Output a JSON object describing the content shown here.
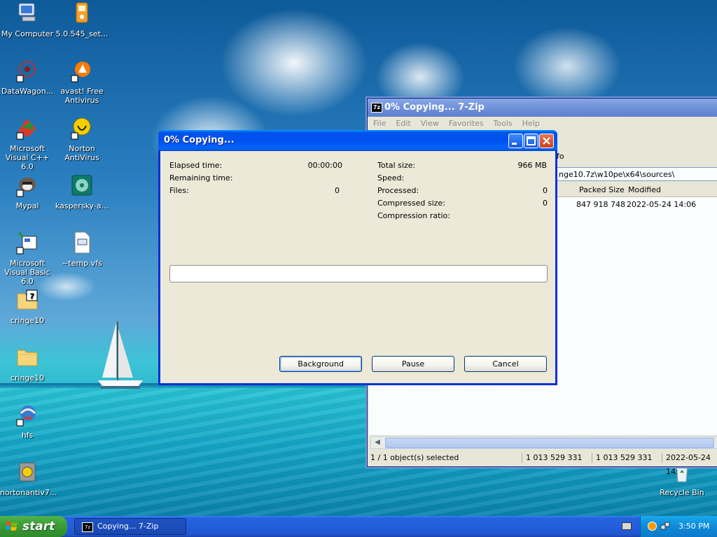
{
  "desktop": {
    "icons": [
      {
        "label": "My Computer",
        "icon": "my-computer-icon"
      },
      {
        "label": "5.0.545_set...",
        "icon": "installer-icon"
      },
      {
        "label": "DataWagon...",
        "icon": "datawagon-icon"
      },
      {
        "label": "avast! Free Antivirus",
        "icon": "avast-icon"
      },
      {
        "label": "Microsoft Visual C++ 6.0",
        "icon": "visual-cpp-icon"
      },
      {
        "label": "Norton AntiVirus",
        "icon": "norton-icon"
      },
      {
        "label": "Mypal",
        "icon": "mypal-icon"
      },
      {
        "label": "kaspersky-a...",
        "icon": "kaspersky-icon"
      },
      {
        "label": "Microsoft Visual Basic 6.0",
        "icon": "visual-basic-icon"
      },
      {
        "label": "~temp.vfs",
        "icon": "document-icon"
      },
      {
        "label": "cringe10",
        "icon": "7zip-folder-icon"
      },
      {
        "label": "cringe10",
        "icon": "folder-icon"
      },
      {
        "label": "hfs",
        "icon": "hfs-icon"
      },
      {
        "label": "nortonantiv7...",
        "icon": "norton-installer-icon"
      },
      {
        "label": "Recycle Bin",
        "icon": "recycle-bin-icon"
      }
    ]
  },
  "zip_window": {
    "app_icon": "7z",
    "title": "0% Copying... 7-Zip",
    "menu": [
      "File",
      "Edit",
      "View",
      "Favorites",
      "Tools",
      "Help"
    ],
    "toolbar_info_label": "fo",
    "address": "nge10.7z\\w10pe\\x64\\sources\\",
    "columns": {
      "packed_size": "Packed Size",
      "modified": "Modified"
    },
    "row": {
      "packed_size": "847 918 748",
      "modified": "2022-05-24 14:06"
    },
    "status": {
      "selection": "1 / 1 object(s) selected",
      "size": "1 013 529 331",
      "packed": "1 013 529 331",
      "modified": "2022-05-24 14:"
    }
  },
  "progress_dialog": {
    "title": "0% Copying...",
    "left": [
      {
        "label": "Elapsed time:",
        "value": "00:00:00"
      },
      {
        "label": "Remaining time:",
        "value": ""
      },
      {
        "label": "Files:",
        "value": "0"
      }
    ],
    "right": [
      {
        "label": "Total size:",
        "value": "966 MB"
      },
      {
        "label": "Speed:",
        "value": ""
      },
      {
        "label": "Processed:",
        "value": "0"
      },
      {
        "label": "Compressed size:",
        "value": "0"
      },
      {
        "label": "Compression ratio:",
        "value": ""
      }
    ],
    "progress_fraction": 0,
    "buttons": {
      "background": "Background",
      "pause": "Pause",
      "cancel": "Cancel"
    }
  },
  "taskbar": {
    "start_label": "start",
    "task_icon": "7z",
    "task_label": "Copying... 7-Zip",
    "clock": "3:50 PM"
  },
  "colors": {
    "xp_blue_title": "#0053ee",
    "progress_fill": "#2ec14b",
    "start_green": "#3a9c37"
  }
}
